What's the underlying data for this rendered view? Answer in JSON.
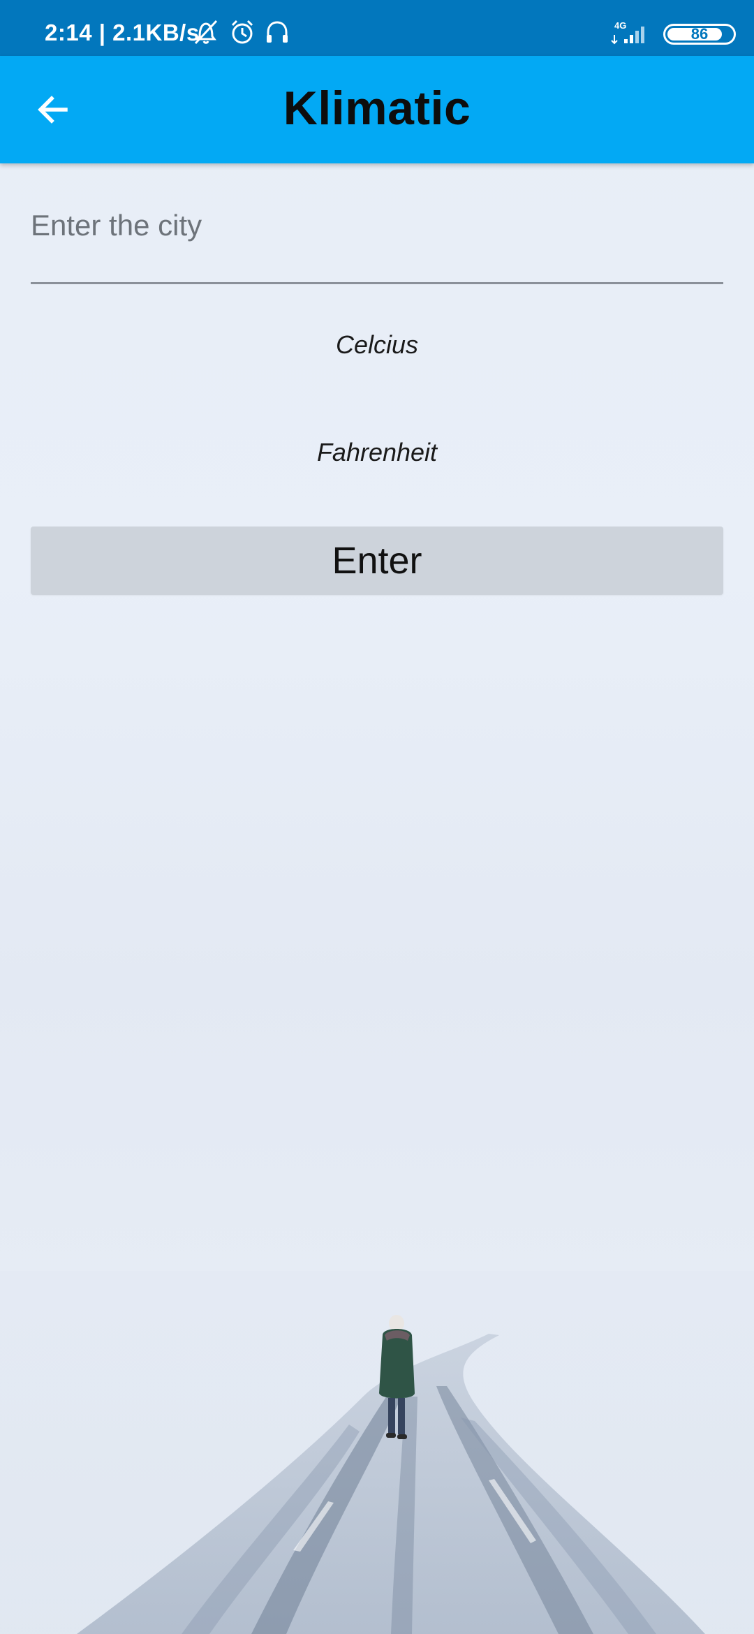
{
  "status_bar": {
    "time": "2:14 | 2.1KB/s",
    "network": "4G",
    "battery": "86",
    "battery_level": 0.86,
    "icons": [
      "vibrate-off-icon",
      "alarm-icon",
      "headphones-icon",
      "signal-icon",
      "battery-icon"
    ]
  },
  "app_bar": {
    "title": "Klimatic",
    "back_icon": "arrow-back-icon"
  },
  "form": {
    "city_placeholder": "Enter the city",
    "city_value": "",
    "celsius_label": "Celcius",
    "fahrenheit_label": "Fahrenheit",
    "enter_label": "Enter"
  },
  "colors": {
    "status_bar": "#0277bd",
    "app_bar": "#03a9f4",
    "button": "#cdd3db",
    "background": "#e7edf6"
  }
}
